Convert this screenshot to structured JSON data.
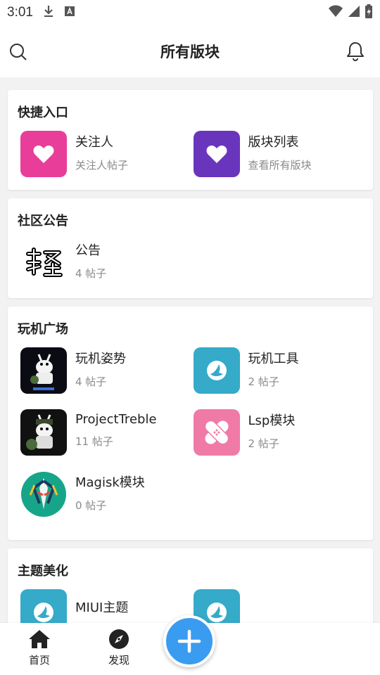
{
  "status": {
    "time": "3:01"
  },
  "header": {
    "title": "所有版块"
  },
  "sections": [
    {
      "title": "快捷入口",
      "items": [
        {
          "name": "关注人",
          "sub": "关注人帖子",
          "color": "#e83e9a",
          "icon": "heart-icon"
        },
        {
          "name": "版块列表",
          "sub": "查看所有版块",
          "color": "#6a35bd",
          "icon": "heart-icon"
        }
      ]
    },
    {
      "title": "社区公告",
      "items": [
        {
          "name": "公告",
          "sub": "4 帖子",
          "icon": "qing-logo"
        }
      ]
    },
    {
      "title": "玩机广场",
      "items": [
        {
          "name": "玩机姿势",
          "sub": "4 帖子",
          "icon": "fastboot-bunny-image"
        },
        {
          "name": "玩机工具",
          "sub": "2 帖子",
          "color": "#35aac9",
          "icon": "bird-icon"
        },
        {
          "name": "ProjectTreble",
          "sub": "11 帖子",
          "icon": "treble-bunny-image"
        },
        {
          "name": "Lsp模块",
          "sub": "2 帖子",
          "color": "#f07aa6",
          "icon": "bandage-icon"
        },
        {
          "name": "Magisk模块",
          "sub": "0 帖子",
          "icon": "magisk-icon"
        }
      ]
    },
    {
      "title": "主题美化",
      "items": [
        {
          "name": "MIUI主题",
          "sub": "",
          "color": "#35aac9",
          "icon": "bird-icon"
        },
        {
          "name": "",
          "sub": "",
          "color": "#35aac9",
          "icon": "bird-icon"
        }
      ]
    }
  ],
  "nav": {
    "home": "首页",
    "discover": "发现"
  },
  "colors": {
    "fab": "#3a9cf0",
    "pink": "#e83e9a",
    "purple": "#6a35bd",
    "teal": "#35aac9",
    "rose": "#f07aa6",
    "magisk": "#17a589"
  }
}
